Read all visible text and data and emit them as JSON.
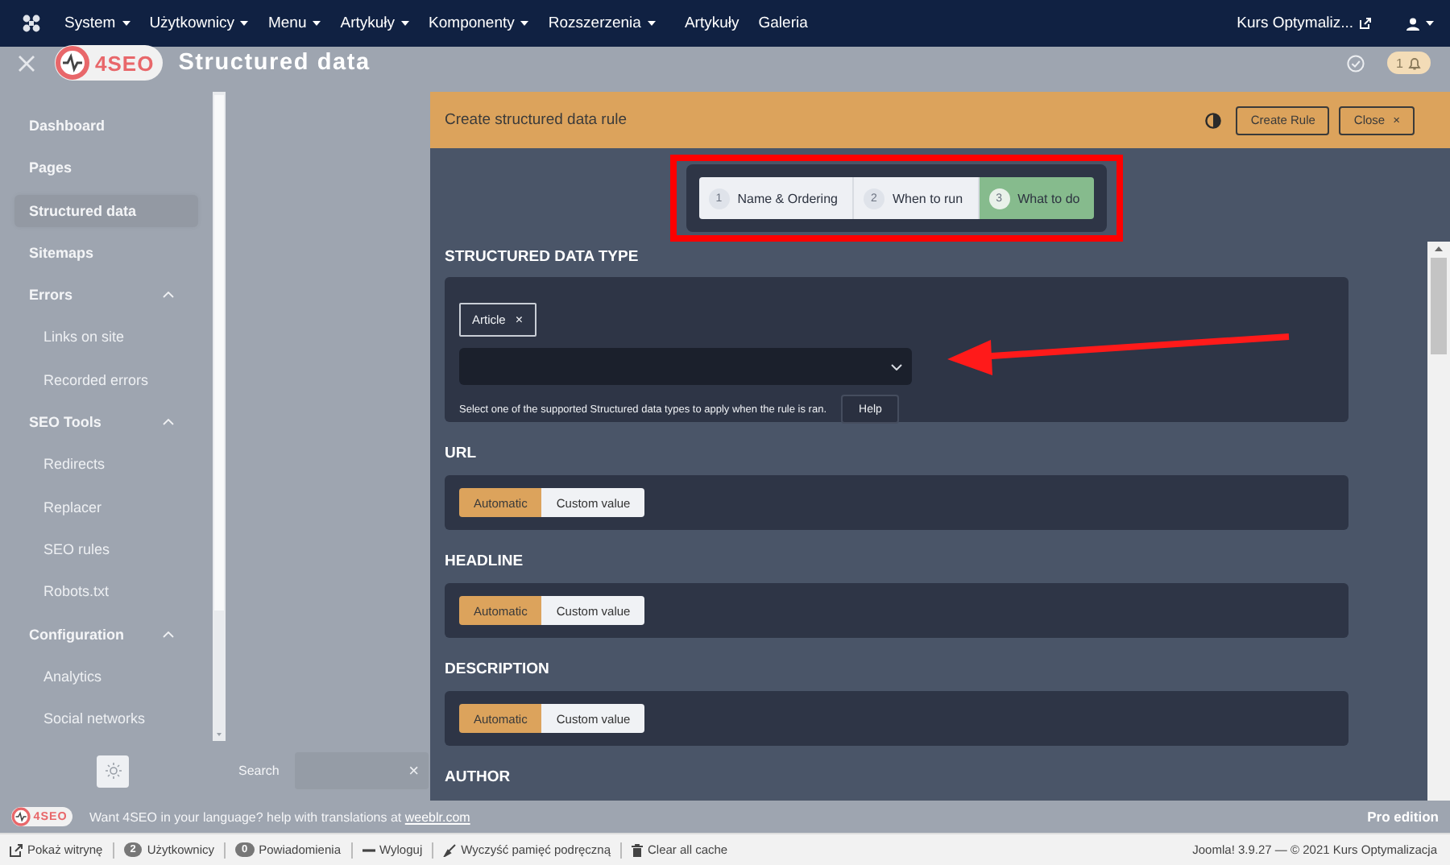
{
  "topbar": {
    "menus": [
      {
        "label": "System",
        "dropdown": true
      },
      {
        "label": "Użytkownicy",
        "dropdown": true
      },
      {
        "label": "Menu",
        "dropdown": true
      },
      {
        "label": "Artykuły",
        "dropdown": true
      },
      {
        "label": "Komponenty",
        "dropdown": true
      },
      {
        "label": "Rozszerzenia",
        "dropdown": true
      },
      {
        "label": "Artykuły",
        "dropdown": false
      },
      {
        "label": "Galeria",
        "dropdown": false
      }
    ],
    "site": "Kurs Optymaliz..."
  },
  "header": {
    "logo": "4SEO",
    "title": "Structured data",
    "notifications": "1"
  },
  "sidebar": {
    "items": [
      {
        "label": "Dashboard",
        "selected": false
      },
      {
        "label": "Pages",
        "selected": false
      },
      {
        "label": "Structured data",
        "selected": true
      },
      {
        "label": "Sitemaps",
        "selected": false
      },
      {
        "label": "Errors",
        "selected": false,
        "expanded": true,
        "children": [
          {
            "label": "Links on site",
            "selected": false
          },
          {
            "label": "Recorded errors",
            "selected": false
          }
        ]
      },
      {
        "label": "SEO Tools",
        "selected": false,
        "expanded": true,
        "children": [
          {
            "label": "Redirects",
            "selected": false
          },
          {
            "label": "Replacer",
            "selected": false
          },
          {
            "label": "SEO rules",
            "selected": false
          },
          {
            "label": "Robots.txt",
            "selected": false
          }
        ]
      },
      {
        "label": "Configuration",
        "selected": false,
        "expanded": true,
        "children": [
          {
            "label": "Analytics",
            "selected": false
          },
          {
            "label": "Social networks",
            "selected": false
          }
        ]
      }
    ],
    "search": {
      "label": "Search",
      "clear": "×"
    }
  },
  "panel": {
    "title": "Create structured data rule",
    "create_button": "Create Rule",
    "close_button": "Close",
    "close_icon": "×",
    "steps_highlighted": true,
    "steps": [
      {
        "number": "1",
        "label": "Name & Ordering",
        "selected": false
      },
      {
        "number": "2",
        "label": "When to run",
        "selected": false
      },
      {
        "number": "3",
        "label": "What to do",
        "selected": true
      }
    ],
    "sections": [
      {
        "kind": "type",
        "heading": "STRUCTURED DATA TYPE",
        "tag": "Article",
        "tag_remove": "×",
        "help_text": "Select one of the supported Structured data types to apply when the rule is ran.",
        "help_button": "Help",
        "arrow": true
      },
      {
        "kind": "toggle",
        "heading": "URL",
        "options": [
          {
            "label": "Automatic",
            "selected": true
          },
          {
            "label": "Custom value",
            "selected": false
          }
        ]
      },
      {
        "kind": "toggle",
        "heading": "HEADLINE",
        "options": [
          {
            "label": "Automatic",
            "selected": true
          },
          {
            "label": "Custom value",
            "selected": false
          }
        ]
      },
      {
        "kind": "toggle",
        "heading": "DESCRIPTION",
        "options": [
          {
            "label": "Automatic",
            "selected": true
          },
          {
            "label": "Custom value",
            "selected": false
          }
        ]
      },
      {
        "kind": "heading",
        "heading": "AUTHOR"
      }
    ]
  },
  "footer": {
    "logo": "4SEO",
    "message": "Want 4SEO in your language? help with translations at",
    "link": "weeblr.com",
    "edition": "Pro edition"
  },
  "statusbar": {
    "items": [
      {
        "label": "Pokaż witrynę"
      },
      {
        "badge": "2",
        "label": "Użytkownicy"
      },
      {
        "badge": "0",
        "label": "Powiadomienia"
      },
      {
        "label": "Wyloguj"
      },
      {
        "label": "Wyczyść pamięć podręczną"
      },
      {
        "label": "Clear all cache"
      }
    ],
    "version": "Joomla! 3.9.27 — © 2021 Kurs Optymalizacja"
  }
}
